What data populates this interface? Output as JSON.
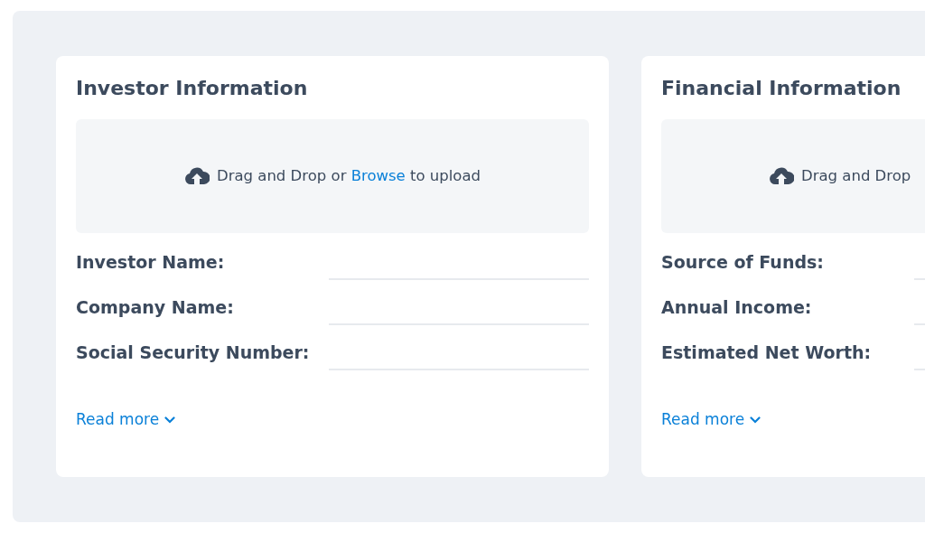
{
  "cards": [
    {
      "title": "Investor Information",
      "upload": {
        "text": "Drag and Drop or",
        "link": "Browse",
        "after": "to upload"
      },
      "fields": [
        {
          "label": "Investor Name:"
        },
        {
          "label": "Company Name:"
        },
        {
          "label": "Social Security Number:"
        }
      ],
      "read_more": "Read more"
    },
    {
      "title": "Financial Information",
      "upload": {
        "text": "Drag and Drop"
      },
      "fields": [
        {
          "label": "Source of Funds:"
        },
        {
          "label": "Annual Income:"
        },
        {
          "label": "Estimated Net Worth:"
        }
      ],
      "read_more": "Read more"
    }
  ]
}
